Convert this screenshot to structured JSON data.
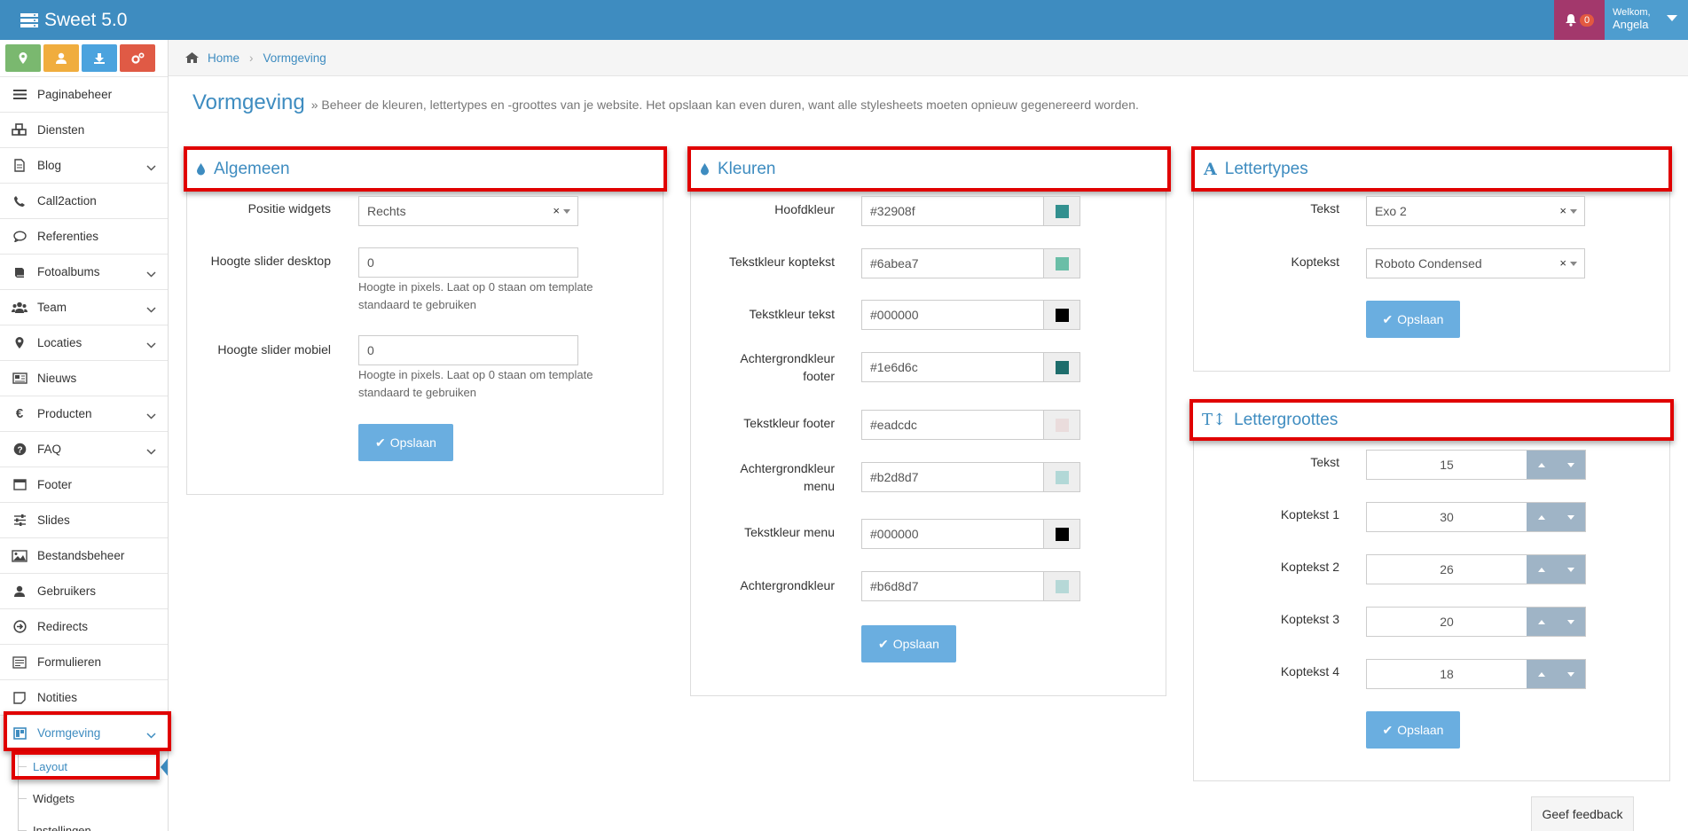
{
  "app": {
    "title": "Sweet 5.0"
  },
  "topbar": {
    "notifications_count": "0",
    "welcome_line1": "Welkom,",
    "welcome_line2": "Angela"
  },
  "quick_buttons": [
    {
      "icon": "map-marker-icon",
      "color": "#7ab86f"
    },
    {
      "icon": "user-icon",
      "color": "#f0ad3e"
    },
    {
      "icon": "download-icon",
      "color": "#4ba3de"
    },
    {
      "icon": "settings-icon",
      "color": "#e05a45"
    }
  ],
  "sidebar": {
    "items": [
      {
        "label": "Paginabeheer",
        "icon": "bars-icon",
        "chevron": false
      },
      {
        "label": "Diensten",
        "icon": "cubes-icon",
        "chevron": false
      },
      {
        "label": "Blog",
        "icon": "file-icon",
        "chevron": true
      },
      {
        "label": "Call2action",
        "icon": "phone-icon",
        "chevron": false
      },
      {
        "label": "Referenties",
        "icon": "comment-icon",
        "chevron": false
      },
      {
        "label": "Fotoalbums",
        "icon": "book-icon",
        "chevron": true
      },
      {
        "label": "Team",
        "icon": "users-icon",
        "chevron": true
      },
      {
        "label": "Locaties",
        "icon": "map-marker-icon",
        "chevron": true
      },
      {
        "label": "Nieuws",
        "icon": "newspaper-icon",
        "chevron": false
      },
      {
        "label": "Producten",
        "icon": "euro-icon",
        "chevron": true
      },
      {
        "label": "FAQ",
        "icon": "question-icon",
        "chevron": true
      },
      {
        "label": "Footer",
        "icon": "window-icon",
        "chevron": false
      },
      {
        "label": "Slides",
        "icon": "sliders-icon",
        "chevron": false
      },
      {
        "label": "Bestandsbeheer",
        "icon": "image-icon",
        "chevron": false
      },
      {
        "label": "Gebruikers",
        "icon": "user-icon",
        "chevron": false
      },
      {
        "label": "Redirects",
        "icon": "arrow-circle-icon",
        "chevron": false
      },
      {
        "label": "Formulieren",
        "icon": "form-icon",
        "chevron": false
      },
      {
        "label": "Notities",
        "icon": "note-icon",
        "chevron": false
      },
      {
        "label": "Vormgeving",
        "icon": "layout-icon",
        "chevron": true
      }
    ],
    "subitems": [
      "Layout",
      "Widgets",
      "Instellingen"
    ]
  },
  "breadcrumb": {
    "home": "Home",
    "current": "Vormgeving"
  },
  "page": {
    "title": "Vormgeving",
    "description": "» Beheer de kleuren, lettertypes en -groottes van je website. Het opslaan kan even duren, want alle stylesheets moeten opnieuw gegenereerd worden."
  },
  "algemeen": {
    "title": "Algemeen",
    "positie_label": "Positie widgets",
    "positie_value": "Rechts",
    "desktop_label": "Hoogte slider desktop",
    "desktop_value": "0",
    "desktop_help": "Hoogte in pixels. Laat op 0 staan om template standaard te gebruiken",
    "mobiel_label": "Hoogte slider mobiel",
    "mobiel_value": "0",
    "mobiel_help": "Hoogte in pixels. Laat op 0 staan om template standaard te gebruiken",
    "save": "Opslaan"
  },
  "kleuren": {
    "title": "Kleuren",
    "rows": [
      {
        "label": "Hoofdkleur",
        "value": "#32908f",
        "color": "#32908f"
      },
      {
        "label": "Tekstkleur koptekst",
        "value": "#6abea7",
        "color": "#6abea7"
      },
      {
        "label": "Tekstkleur tekst",
        "value": "#000000",
        "color": "#000000"
      },
      {
        "label": "Achtergrondkleur footer",
        "value": "#1e6d6c",
        "color": "#1e6d6c"
      },
      {
        "label": "Tekstkleur footer",
        "value": "#eadcdc",
        "color": "#eadcdc"
      },
      {
        "label": "Achtergrondkleur menu",
        "value": "#b2d8d7",
        "color": "#b2d8d7"
      },
      {
        "label": "Tekstkleur menu",
        "value": "#000000",
        "color": "#000000"
      },
      {
        "label": "Achtergrondkleur",
        "value": "#b6d8d7",
        "color": "#b6d8d7"
      }
    ],
    "save": "Opslaan"
  },
  "lettertypes": {
    "title": "Lettertypes",
    "tekst_label": "Tekst",
    "tekst_value": "Exo 2",
    "koptekst_label": "Koptekst",
    "koptekst_value": "Roboto Condensed",
    "save": "Opslaan"
  },
  "lettergroottes": {
    "title": "Lettergroottes",
    "rows": [
      {
        "label": "Tekst",
        "value": "15"
      },
      {
        "label": "Koptekst 1",
        "value": "30"
      },
      {
        "label": "Koptekst 2",
        "value": "26"
      },
      {
        "label": "Koptekst 3",
        "value": "20"
      },
      {
        "label": "Koptekst 4",
        "value": "18"
      }
    ],
    "save": "Opslaan"
  },
  "feedback": "Geef feedback",
  "colors": {
    "accent": "#3e8cc0",
    "highlight": "#e00000",
    "button": "#6aaee0"
  }
}
